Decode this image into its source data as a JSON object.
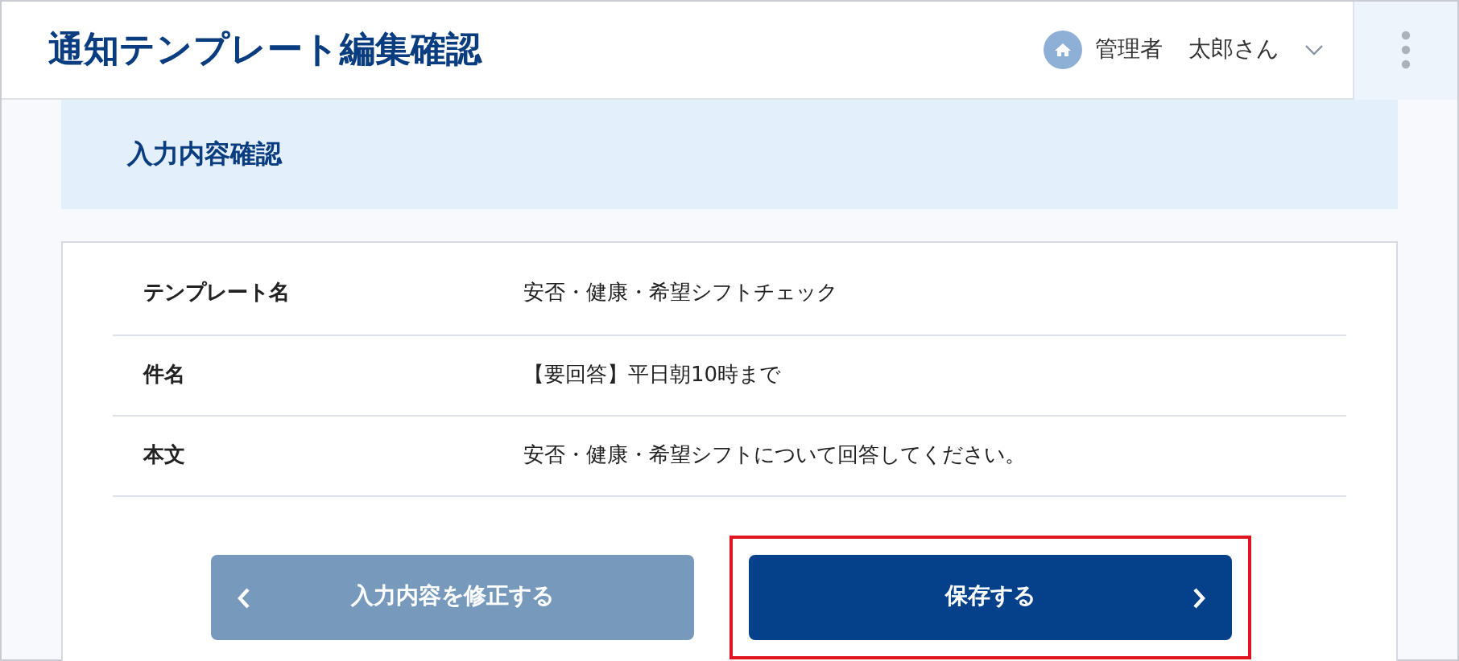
{
  "header": {
    "title": "通知テンプレート編集確認",
    "user": {
      "role": "管理者",
      "name": "太郎さん"
    }
  },
  "section": {
    "title": "入力内容確認"
  },
  "rows": [
    {
      "label": "テンプレート名",
      "value": "安否・健康・希望シフトチェック"
    },
    {
      "label": "件名",
      "value": "【要回答】平日朝10時まで"
    },
    {
      "label": "本文",
      "value": "安否・健康・希望シフトについて回答してください。"
    }
  ],
  "buttons": [
    {
      "kind": "back",
      "label": "入力内容を修正する",
      "highlighted": false
    },
    {
      "kind": "save",
      "label": "保存する",
      "highlighted": true
    }
  ]
}
